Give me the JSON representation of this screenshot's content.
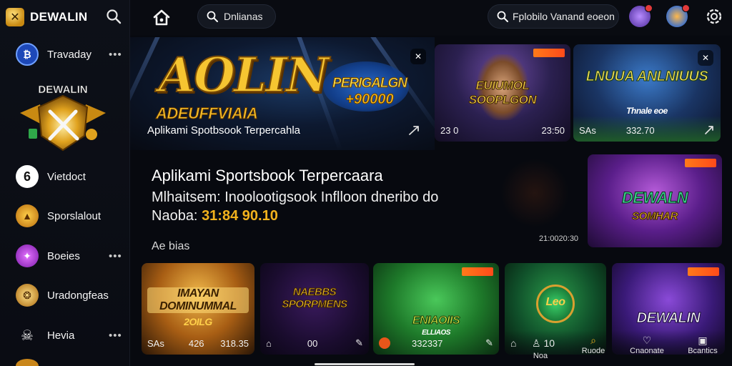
{
  "brand": {
    "name": "DEWALIN",
    "logo_icon": "crossed-swords-logo"
  },
  "sidebar": {
    "banner_text": "DEWALIN",
    "items": [
      {
        "label": "Travaday",
        "icon": "coin-ball-icon",
        "more": "•••",
        "color": "#2b5bd6"
      },
      {
        "label": "Vietdoct",
        "icon": "six-badge-icon",
        "more": "",
        "color": "#ffffff"
      },
      {
        "label": "Sporslalout",
        "icon": "flame-shield-icon",
        "more": "",
        "color": "#e7a21b"
      },
      {
        "label": "Boeies",
        "icon": "star-orb-icon",
        "more": "•••",
        "color": "#9c2fd1"
      },
      {
        "label": "Uradongfeas",
        "icon": "lion-crest-icon",
        "more": "",
        "color": "#c9861a"
      },
      {
        "label": "Hevia",
        "icon": "skull-icon",
        "more": "•••",
        "color": "#d9d9d9"
      }
    ]
  },
  "topbar": {
    "search_text": "Dnlianas",
    "promo_search_text": "Fplobilo Vanand eoeon",
    "home_icon": "home-icon",
    "notif_icon": "trophy-badge-icon",
    "wallet_icon": "chip-badge-icon",
    "settings_icon": "gear-icon"
  },
  "hero": {
    "logo_text": "AOLIN",
    "logo_sub": "ADEUFFVIAIA",
    "caption": "Aplikami Spotbsook Terpercahla",
    "promo_title": "PERIGALGN",
    "promo_amount": "+90000",
    "share_icon": "share-icon"
  },
  "top_cards": [
    {
      "title": "EUIUMOL SOOPLGON",
      "left_meta": "23 0",
      "right_meta": "23:50",
      "badge_icon": "hot-tag"
    },
    {
      "title": "LNUUA ANLNIUUS",
      "subtitle": "Thnale eoe",
      "left_meta": "SAs",
      "mid_meta": "332.70",
      "badge_icon": "close-icon"
    }
  ],
  "info": {
    "title": "Aplikami Sportsbook Terpercaara",
    "line2": "Mlhaitsem: Inoolootigsook Inflloon dneribo do",
    "line3_prefix": "Naoba: ",
    "line3_amount": "31:84 90.10",
    "more_label": "Ae bias",
    "time": "21:0020:30"
  },
  "side_card": {
    "title": "DEWALN",
    "subtitle": "SOMHAR"
  },
  "bottom_cards": [
    {
      "title": "IMAYAN DOMINUMMAL",
      "subtitle": "2OILG",
      "left_meta": "SAs",
      "mid_meta": "426",
      "right_meta": "318.35"
    },
    {
      "title": "NAEBBS SPORPMENS",
      "mid_meta": "00"
    },
    {
      "title": "ENIAOIIS",
      "subtitle": "ELLIAOS",
      "right_meta": "332337"
    },
    {
      "title": "Leo",
      "mid_meta": "10"
    },
    {
      "title": "DEWALIN"
    }
  ],
  "bottom_nav": [
    {
      "label": "Noa",
      "icon": "user-icon"
    },
    {
      "label": "Ruode",
      "icon": "search-icon"
    },
    {
      "label": "Cnaonate",
      "icon": "heart-icon"
    },
    {
      "label": "Bcantics",
      "icon": "save-icon"
    }
  ]
}
